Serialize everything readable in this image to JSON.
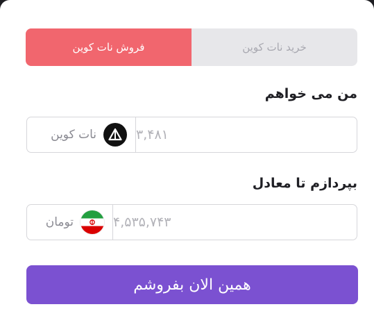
{
  "tabs": {
    "buy_label": "خرید نات کوین",
    "sell_label": "فروش نات کوین",
    "active": "sell"
  },
  "want": {
    "label": "من می خواهم",
    "amount": "۳,۴۸۱",
    "currency": "نات کوین",
    "icon": "notcoin-icon"
  },
  "pay": {
    "label": "بپردازم تا معادل",
    "amount": "۴,۵۳۵,۷۴۳",
    "currency": "تومان",
    "icon": "iran-flag-icon"
  },
  "action": {
    "label": "همین الان بفروشم"
  },
  "colors": {
    "sell_tab": "#f1666e",
    "button": "#7b51d1",
    "tab_bg": "#e7e7ea"
  }
}
